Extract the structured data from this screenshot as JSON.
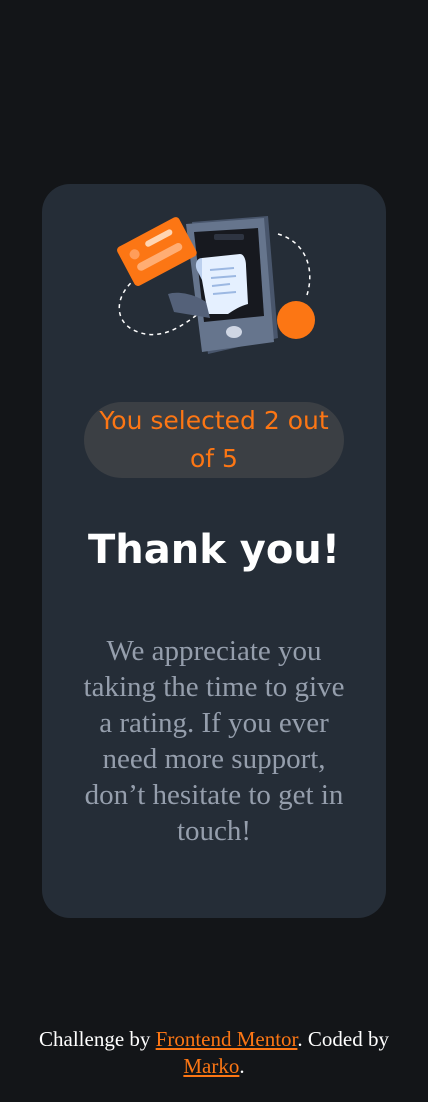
{
  "colors": {
    "background": "#131518",
    "card": "#252d37",
    "accent": "#fc7614",
    "pill": "#3b3f44",
    "heading": "#ffffff",
    "body_text": "#959eac"
  },
  "illustration": {
    "icon": "payment-phone-illustration"
  },
  "selection": {
    "text": "You selected 2 out of 5",
    "selected": 2,
    "total": 5
  },
  "thanks": {
    "title": "Thank you!",
    "message": "We appreciate you taking the time to give a rating. If you ever need more support, don’t hesitate to get in touch!"
  },
  "footer": {
    "prefix": "Challenge by ",
    "link1": "Frontend Mentor",
    "middle": ". Coded by",
    "link2": "Marko",
    "suffix": "."
  }
}
